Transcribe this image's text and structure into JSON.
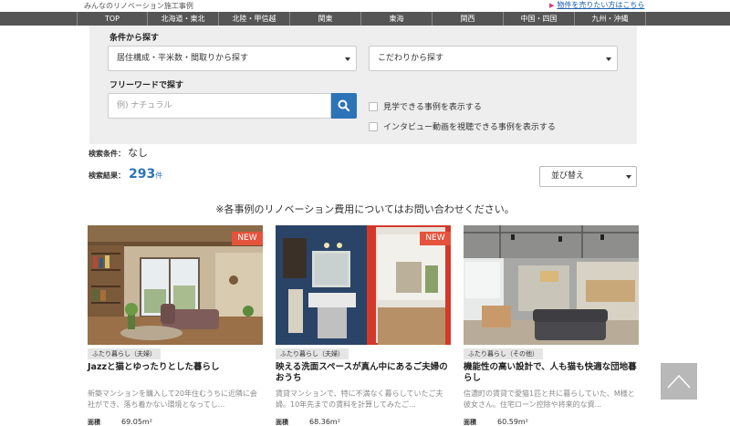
{
  "header": {
    "site_title": "みんなのリノベーション施工事例",
    "sell_link": "物件を売りたい方はこちら"
  },
  "nav": {
    "items": [
      "TOP",
      "北海道・東北",
      "北陸・甲信越",
      "関東",
      "東海",
      "関西",
      "中国・四国",
      "九州・沖縄"
    ]
  },
  "search": {
    "conditions_label": "条件から探す",
    "layout_select": "居住構成・平米数・間取りから探す",
    "feature_select": "こだわりから探す",
    "keyword_label": "フリーワードで探す",
    "keyword_placeholder": "例) ナチュラル",
    "check_visit": "見学できる事例を表示する",
    "check_interview": "インタビュー動画を視聴できる事例を表示する"
  },
  "results": {
    "condition_label": "検索条件：",
    "condition_value": "なし",
    "count_label": "検索結果：",
    "count": "293",
    "count_unit": "件",
    "sort_label": "並び替え"
  },
  "notice": "※各事例のリノベーション費用についてはお問い合わせください。",
  "cards": [
    {
      "badge": "NEW",
      "tag": "ふたり暮らし（夫婦）",
      "title": "Jazzと猫とゆったりとした暮らし",
      "desc": "新築マンションを購入して20年住むうちに近隣に会社ができ、落ち着かない環境となってし...",
      "area_label": "面積",
      "area": "69.05m²"
    },
    {
      "badge": "NEW",
      "tag": "ふたり暮らし（夫婦）",
      "title": "映える洗面スペースが真ん中にあるご夫婦のおうち",
      "desc": "賃貸マンションで、特に不満なく暮らしていたご夫婦。10年先までの賃料を計算してみたご...",
      "area_label": "面積",
      "area": "68.36m²"
    },
    {
      "badge": "",
      "tag": "ふたり暮らし（その他）",
      "title": "機能性の高い設計で、人も猫も快適な団地暮らし",
      "desc": "信濃町の賃貸で愛猫1匹と共に暮らしていた、M様と彼女さん。住宅ローン控除や将来的な資...",
      "area_label": "面積",
      "area": "60.59m²"
    }
  ]
}
